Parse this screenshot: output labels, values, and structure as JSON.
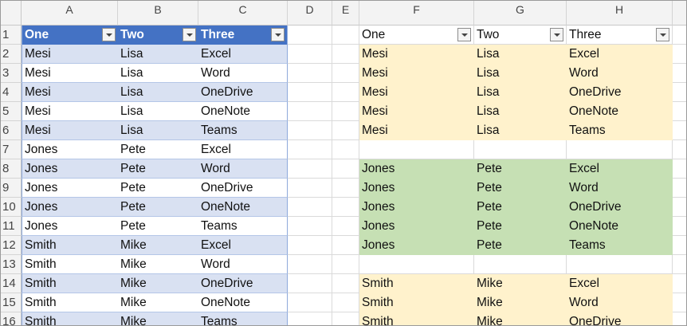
{
  "columns": [
    "A",
    "B",
    "C",
    "D",
    "E",
    "F",
    "G",
    "H"
  ],
  "rows": [
    "1",
    "2",
    "3",
    "4",
    "5",
    "6",
    "7",
    "8",
    "9",
    "10",
    "11",
    "12",
    "13",
    "14",
    "15",
    "16"
  ],
  "tableA": {
    "headers": [
      "One",
      "Two",
      "Three"
    ],
    "header_color": "#4472c4",
    "band_color": "#d9e1f2",
    "rows": [
      [
        "Mesi",
        "Lisa",
        "Excel"
      ],
      [
        "Mesi",
        "Lisa",
        "Word"
      ],
      [
        "Mesi",
        "Lisa",
        "OneDrive"
      ],
      [
        "Mesi",
        "Lisa",
        "OneNote"
      ],
      [
        "Mesi",
        "Lisa",
        "Teams"
      ],
      [
        "Jones",
        "Pete",
        "Excel"
      ],
      [
        "Jones",
        "Pete",
        "Word"
      ],
      [
        "Jones",
        "Pete",
        "OneDrive"
      ],
      [
        "Jones",
        "Pete",
        "OneNote"
      ],
      [
        "Jones",
        "Pete",
        "Teams"
      ],
      [
        "Smith",
        "Mike",
        "Excel"
      ],
      [
        "Smith",
        "Mike",
        "Word"
      ],
      [
        "Smith",
        "Mike",
        "OneDrive"
      ],
      [
        "Smith",
        "Mike",
        "OneNote"
      ],
      [
        "Smith",
        "Mike",
        "Teams"
      ]
    ]
  },
  "tableF": {
    "headers": [
      "One",
      "Two",
      "Three"
    ],
    "group_colors": {
      "yellow": "#fff2cc",
      "green": "#c6e0b4"
    },
    "rows": [
      {
        "cells": [
          "Mesi",
          "Lisa",
          "Excel"
        ],
        "fill": "yellow"
      },
      {
        "cells": [
          "Mesi",
          "Lisa",
          "Word"
        ],
        "fill": "yellow"
      },
      {
        "cells": [
          "Mesi",
          "Lisa",
          "OneDrive"
        ],
        "fill": "yellow"
      },
      {
        "cells": [
          "Mesi",
          "Lisa",
          "OneNote"
        ],
        "fill": "yellow"
      },
      {
        "cells": [
          "Mesi",
          "Lisa",
          "Teams"
        ],
        "fill": "yellow"
      },
      {
        "cells": [
          "",
          "",
          ""
        ],
        "fill": "none"
      },
      {
        "cells": [
          "Jones",
          "Pete",
          "Excel"
        ],
        "fill": "green"
      },
      {
        "cells": [
          "Jones",
          "Pete",
          "Word"
        ],
        "fill": "green"
      },
      {
        "cells": [
          "Jones",
          "Pete",
          "OneDrive"
        ],
        "fill": "green"
      },
      {
        "cells": [
          "Jones",
          "Pete",
          "OneNote"
        ],
        "fill": "green"
      },
      {
        "cells": [
          "Jones",
          "Pete",
          "Teams"
        ],
        "fill": "green"
      },
      {
        "cells": [
          "",
          "",
          ""
        ],
        "fill": "none"
      },
      {
        "cells": [
          "Smith",
          "Mike",
          "Excel"
        ],
        "fill": "yellow"
      },
      {
        "cells": [
          "Smith",
          "Mike",
          "Word"
        ],
        "fill": "yellow"
      },
      {
        "cells": [
          "Smith",
          "Mike",
          "OneDrive"
        ],
        "fill": "yellow"
      }
    ]
  }
}
